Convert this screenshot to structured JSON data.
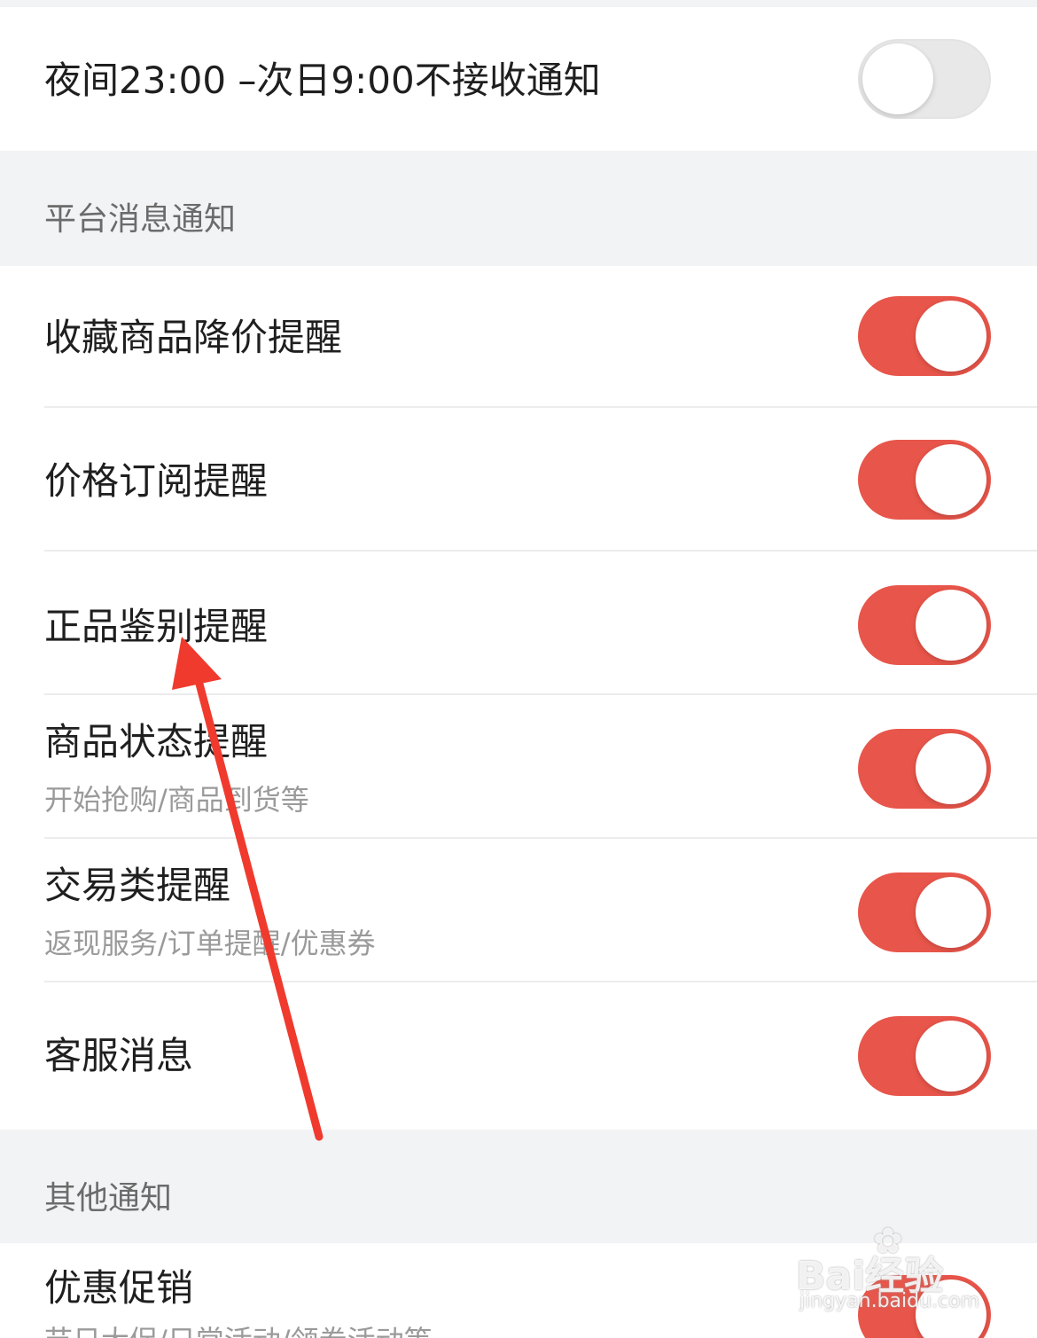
{
  "dnd_row": {
    "label": "夜间23:00 –次日9:00不接收通知",
    "enabled": false
  },
  "platform_section": {
    "header": "平台消息通知",
    "items": [
      {
        "label": "收藏商品降价提醒",
        "sub": "",
        "enabled": true
      },
      {
        "label": "价格订阅提醒",
        "sub": "",
        "enabled": true
      },
      {
        "label": "正品鉴别提醒",
        "sub": "",
        "enabled": true
      },
      {
        "label": "商品状态提醒",
        "sub": "开始抢购/商品到货等",
        "enabled": true
      },
      {
        "label": "交易类提醒",
        "sub": "返现服务/订单提醒/优惠券",
        "enabled": true
      },
      {
        "label": "客服消息",
        "sub": "",
        "enabled": true
      }
    ]
  },
  "other_section": {
    "header": "其他通知",
    "items": [
      {
        "label": "优惠促销",
        "sub": "节日大促/日常活动/领券活动等",
        "enabled": true
      }
    ]
  },
  "watermark": {
    "brand": "Bai经验",
    "url": "jingyan.baidu.com",
    "paw_icon": "paw-icon"
  },
  "colors": {
    "toggle_on": "#e8554a",
    "toggle_off": "#e8e8e8",
    "arrow": "#f03a2e",
    "section_bg": "#f2f3f5"
  }
}
